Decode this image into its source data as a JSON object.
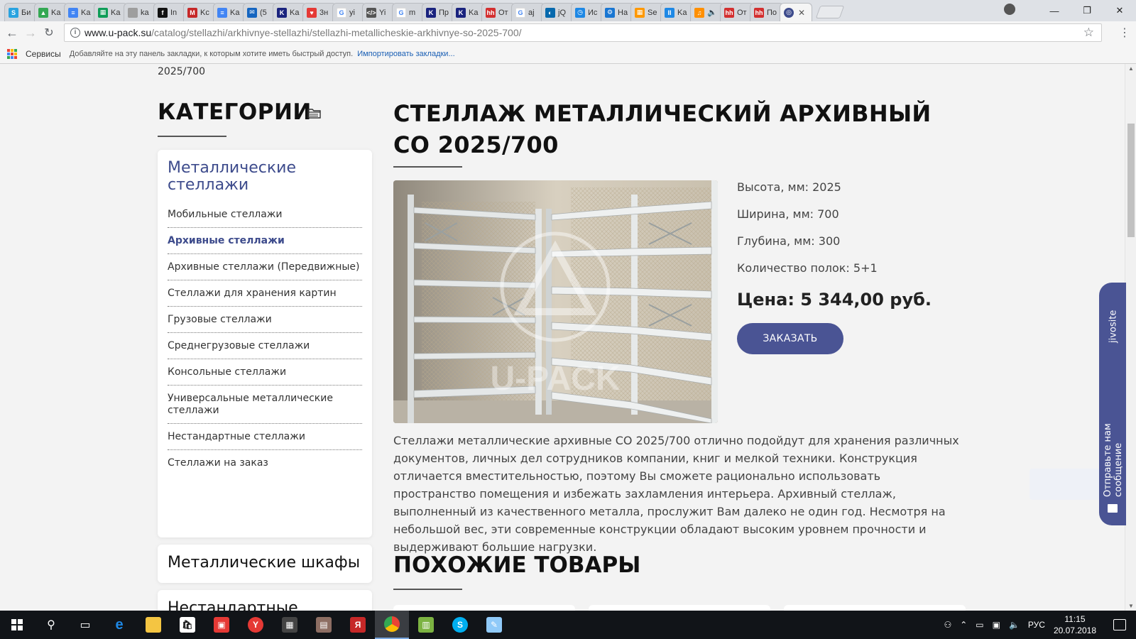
{
  "browser": {
    "tabs": [
      {
        "label": "Би",
        "favicon_color": "#29a3e0",
        "favicon_text": "S"
      },
      {
        "label": "Ka",
        "favicon_color": "#34a853",
        "favicon_text": "▲"
      },
      {
        "label": "Ka",
        "favicon_color": "#4285f4",
        "favicon_text": "≡"
      },
      {
        "label": "Ka",
        "favicon_color": "#0f9d58",
        "favicon_text": "▦"
      },
      {
        "label": "ka",
        "favicon_color": "#9e9e9e",
        "favicon_text": ""
      },
      {
        "label": "In",
        "favicon_color": "#111111",
        "favicon_text": "f"
      },
      {
        "label": "Kc",
        "favicon_color": "#c62828",
        "favicon_text": "M"
      },
      {
        "label": "Ka",
        "favicon_color": "#4285f4",
        "favicon_text": "≡"
      },
      {
        "label": "(5",
        "favicon_color": "#1565c0",
        "favicon_text": "✉"
      },
      {
        "label": "Ka",
        "favicon_color": "#1a237e",
        "favicon_text": "K"
      },
      {
        "label": "3н",
        "favicon_color": "#e53935",
        "favicon_text": "♥"
      },
      {
        "label": "yi",
        "favicon_color": "#ffffff",
        "favicon_text": "G"
      },
      {
        "label": "Yi",
        "favicon_color": "#555555",
        "favicon_text": "</>"
      },
      {
        "label": "m",
        "favicon_color": "#ffffff",
        "favicon_text": "G"
      },
      {
        "label": "Пр",
        "favicon_color": "#1a237e",
        "favicon_text": "K"
      },
      {
        "label": "Ka",
        "favicon_color": "#1a237e",
        "favicon_text": "K"
      },
      {
        "label": "От",
        "favicon_color": "#d32f2f",
        "favicon_text": "hh"
      },
      {
        "label": "aj",
        "favicon_color": "#ffffff",
        "favicon_text": "G"
      },
      {
        "label": "jQ",
        "favicon_color": "#0769ad",
        "favicon_text": "◐"
      },
      {
        "label": "Ис",
        "favicon_color": "#1e88e5",
        "favicon_text": "◷"
      },
      {
        "label": "На",
        "favicon_color": "#1976d2",
        "favicon_text": "⚙"
      },
      {
        "label": "Se",
        "favicon_color": "#ff9800",
        "favicon_text": "▦"
      },
      {
        "label": "Ka",
        "favicon_color": "#1e88e5",
        "favicon_text": "II"
      },
      {
        "label": "🔈",
        "favicon_color": "#ff8f00",
        "favicon_text": "♫"
      },
      {
        "label": "От",
        "favicon_color": "#d32f2f",
        "favicon_text": "hh"
      },
      {
        "label": "По",
        "favicon_color": "#d32f2f",
        "favicon_text": "hh"
      }
    ],
    "active_tab_favicon": "globe-icon",
    "url_host": "www.u-pack.su",
    "url_path": "/catalog/stellazhi/arkhivnye-stellazhi/stellazhi-metallicheskie-arkhivnye-so-2025-700/",
    "bookmarks": {
      "services": "Сервисы",
      "hint": "Добавляйте на эту панель закладки, к которым хотите иметь быстрый доступ.",
      "import": "Импортировать закладки..."
    }
  },
  "page": {
    "breadcrumb_tail": "2025/700",
    "sidebar": {
      "heading": "КАТЕГОРИИ",
      "primary_category": "Металлические стеллажи",
      "subcategories": [
        {
          "label": "Мобильные стеллажи",
          "active": false
        },
        {
          "label": "Архивные стеллажи",
          "active": true
        },
        {
          "label": "Архивные стеллажи (Передвижные)",
          "active": false
        },
        {
          "label": "Стеллажи для хранения картин",
          "active": false
        },
        {
          "label": "Грузовые стеллажи",
          "active": false
        },
        {
          "label": "Среднегрузовые стеллажи",
          "active": false
        },
        {
          "label": "Консольные стеллажи",
          "active": false
        },
        {
          "label": "Универсальные металлические стеллажи",
          "active": false
        },
        {
          "label": "Нестандартные стеллажи",
          "active": false
        },
        {
          "label": "Стеллажи на заказ",
          "active": false
        }
      ],
      "other_categories": [
        "Металлические шкафы",
        "Нестандартные металлоконструкции"
      ]
    },
    "product": {
      "title": "СТЕЛЛАЖ МЕТАЛЛИЧЕСКИЙ АРХИВНЫЙ СО 2025/700",
      "image_watermark": "U-PACK",
      "specs": [
        "Высота, мм: 2025",
        "Ширина, мм: 700",
        "Глубина, мм: 300",
        "Количество полок: 5+1"
      ],
      "price": "Цена: 5 344,00 руб.",
      "order_button": "ЗАКАЗАТЬ",
      "description": "Стеллажи металлические архивные СО 2025/700 отлично подойдут для хранения различных документов, личных дел сотрудников компании, книг и мелкой техники. Конструкция отличается вместительностью, поэтому Вы сможете рационально использовать пространство помещения и избежать захламления интерьера. Архивный стеллаж, выполненный из качественного металла, прослужит Вам далеко не один год. Несмотря на небольшой вес, эти современные конструкции обладают высоким уровнем прочности и выдерживают большие нагрузки."
    },
    "similar_heading": "ПОХОЖИЕ ТОВАРЫ",
    "chat_widget": {
      "brand": "jivosite",
      "label": "Отправьте нам сообщение"
    }
  },
  "taskbar": {
    "language": "РУС",
    "time": "11:15",
    "date": "20.07.2018"
  },
  "colors": {
    "accent": "#4a5494",
    "accent_text": "#3d4b8c"
  }
}
